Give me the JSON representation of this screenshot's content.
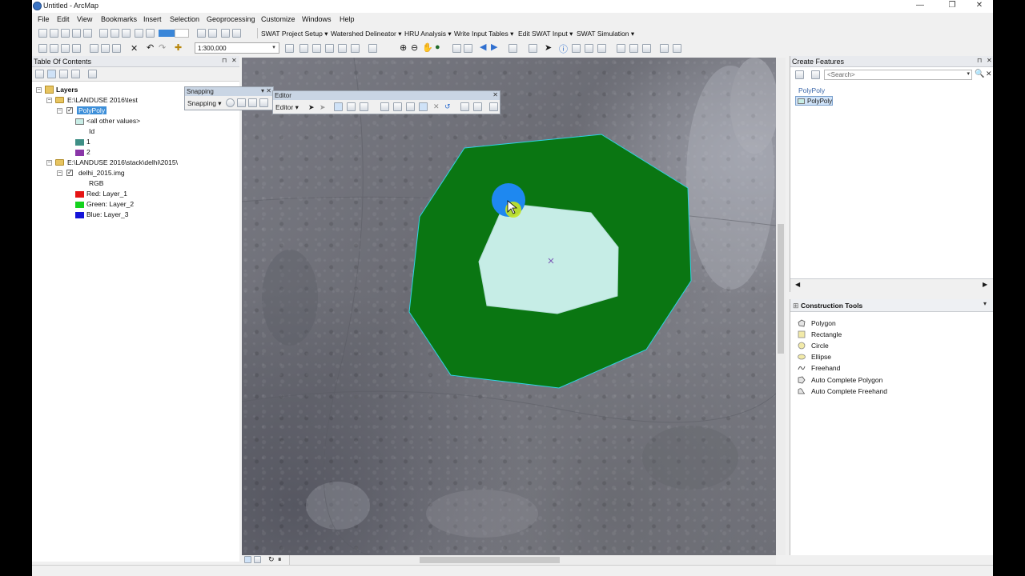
{
  "window": {
    "title": "Untitled - ArcMap"
  },
  "menu": [
    "File",
    "Edit",
    "View",
    "Bookmarks",
    "Insert",
    "Selection",
    "Geoprocessing",
    "Customize",
    "Windows",
    "Help"
  ],
  "swat_toolbar": [
    "SWAT Project Setup",
    "Watershed Delineator",
    "HRU Analysis",
    "Write Input Tables",
    "Edit SWAT Input",
    "SWAT Simulation"
  ],
  "scale": {
    "value": "1:300,000"
  },
  "toc": {
    "title": "Table Of Contents",
    "layers_label": "Layers",
    "group1": "E:\\LANDUSE 2016\\test",
    "layer1": "PolyPoly",
    "layer1_items": [
      {
        "label": "<all other values>",
        "color": "#c8ede6"
      },
      {
        "label": "Id",
        "color": ""
      },
      {
        "label": "1",
        "color": "#3f8f86"
      },
      {
        "label": "2",
        "color": "#8a36a8"
      }
    ],
    "group2": "E:\\LANDUSE 2016\\stack\\delhi\\2015\\",
    "layer2": "delhi_2015.img",
    "layer2_items": [
      {
        "label": "RGB",
        "color": ""
      },
      {
        "label": "Red:  Layer_1",
        "color": "#e51414"
      },
      {
        "label": "Green: Layer_2",
        "color": "#14d21e"
      },
      {
        "label": "Blue:  Layer_3",
        "color": "#1414d8"
      }
    ]
  },
  "snapping": {
    "title": "Snapping",
    "menu": "Snapping"
  },
  "editor": {
    "title": "Editor",
    "menu": "Editor"
  },
  "create_features": {
    "title": "Create Features",
    "search_placeholder": "<Search>",
    "group": "PolyPoly",
    "template": "PolyPoly"
  },
  "construction_tools": {
    "title": "Construction Tools",
    "items": [
      {
        "label": "Polygon",
        "icon": "polygon-icon"
      },
      {
        "label": "Rectangle",
        "icon": "rectangle-icon"
      },
      {
        "label": "Circle",
        "icon": "circle-icon"
      },
      {
        "label": "Ellipse",
        "icon": "ellipse-icon"
      },
      {
        "label": "Freehand",
        "icon": "freehand-icon"
      },
      {
        "label": "Auto Complete Polygon",
        "icon": "auto-complete-polygon-icon"
      },
      {
        "label": "Auto Complete Freehand",
        "icon": "auto-complete-freehand-icon"
      }
    ]
  },
  "colors": {
    "outer_polygon": "#0a7612",
    "inner_polygon": "#c6ede6",
    "selection_outline": "#2fd3e6",
    "cursor_highlight": "#1e88f0"
  }
}
